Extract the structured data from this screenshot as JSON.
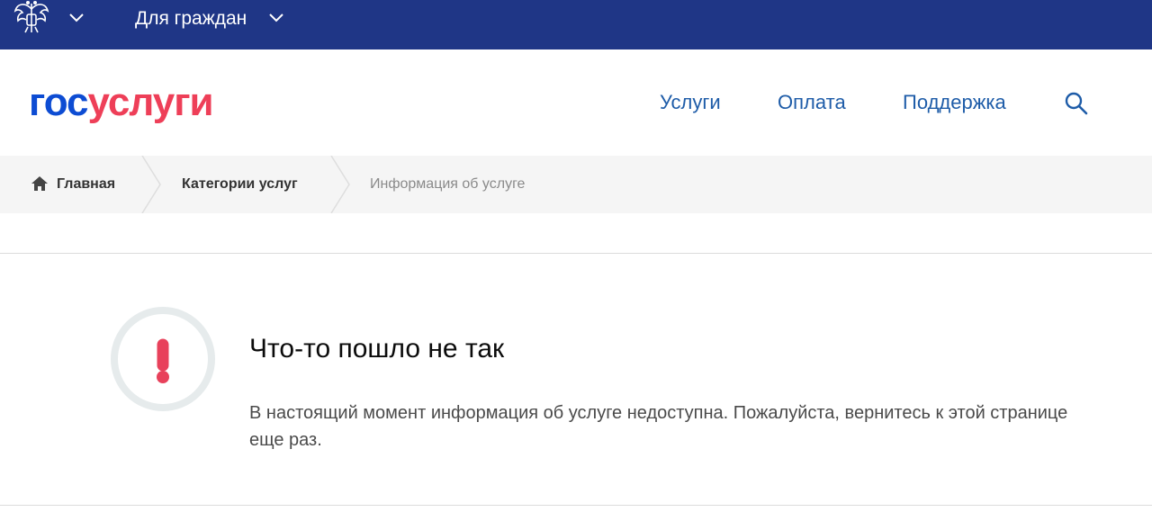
{
  "topbar": {
    "emblem_icon": "russian-coat-of-arms-icon",
    "citizens_label": "Для граждан"
  },
  "header": {
    "logo_part1": "гос",
    "logo_part2": "услуги",
    "nav": [
      {
        "label": "Услуги"
      },
      {
        "label": "Оплата"
      },
      {
        "label": "Поддержка"
      }
    ],
    "search_icon": "search-icon"
  },
  "breadcrumb": {
    "items": [
      {
        "label": "Главная"
      },
      {
        "label": "Категории услуг"
      },
      {
        "label": "Информация об услуге"
      }
    ]
  },
  "error": {
    "icon": "exclamation-icon",
    "title": "Что-то пошло не так",
    "message": "В настоящий момент информация об услуге недоступна. Пожалуйста, вернитесь к этой странице еще раз."
  },
  "colors": {
    "topbar": "#1f3686",
    "logo_blue": "#0d4cd3",
    "logo_red": "#ee3f58",
    "nav_link": "#1e5ca8",
    "error_accent": "#e8415b"
  }
}
